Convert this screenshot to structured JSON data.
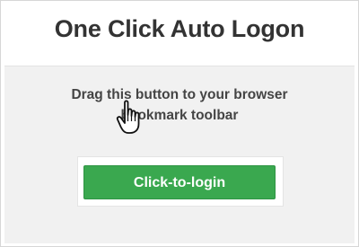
{
  "header": {
    "title": "One Click Auto Logon"
  },
  "panel": {
    "instruction_line1": "Drag this button to your browser",
    "instruction_line2": "bookmark toolbar"
  },
  "login_button": {
    "label": "Click-to-login",
    "color": "#3aa84f"
  },
  "cursor": {
    "icon": "hand-pointer-icon"
  }
}
